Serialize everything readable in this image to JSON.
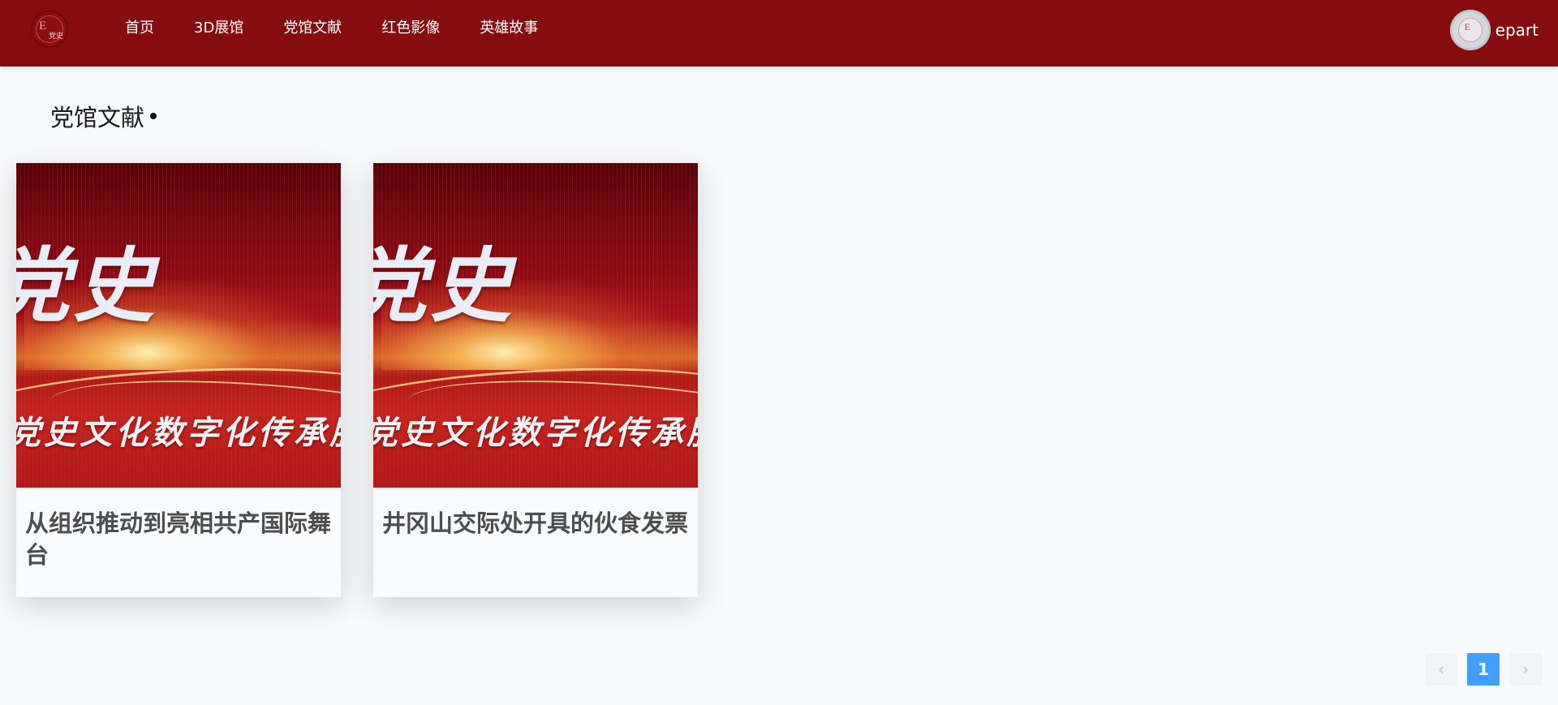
{
  "brand": {
    "logo_text": "党史",
    "logo_letter": "E"
  },
  "nav": {
    "items": [
      {
        "label": "首页"
      },
      {
        "label": "3D展馆"
      },
      {
        "label": "党馆文献"
      },
      {
        "label": "红色影像"
      },
      {
        "label": "英雄故事"
      }
    ]
  },
  "user": {
    "name": "epart",
    "avatar_letter": "E"
  },
  "section": {
    "title": "党馆文献"
  },
  "cards": [
    {
      "banner_big": "党史",
      "banner_sub": "党史文化数字化传承服",
      "title": "从组织推动到亮相共产国际舞台"
    },
    {
      "banner_big": "党史",
      "banner_sub": "党史文化数字化传承服",
      "title": "井冈山交际处开具的伙食发票"
    }
  ],
  "pagination": {
    "prev_icon": "chevron-left-icon",
    "current": "1",
    "next_icon": "chevron-right-icon"
  },
  "colors": {
    "header_bg": "#860d0f",
    "page_bg": "#f8f9fb",
    "pager_active": "#409eff"
  }
}
